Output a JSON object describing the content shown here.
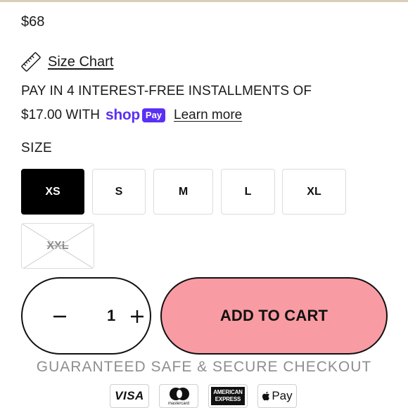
{
  "product": {
    "price": "$68"
  },
  "size_chart": {
    "label": "Size Chart",
    "icon": "ruler-icon"
  },
  "installments": {
    "line1": "PAY IN 4 INTEREST-FREE INSTALLMENTS OF",
    "amount_text": "$17.00 WITH",
    "shop_logo": "shop",
    "pay_badge": "Pay",
    "learn_more": "Learn more",
    "brand_color": "#5a31f4"
  },
  "size_selector": {
    "label": "SIZE",
    "options": [
      {
        "label": "XS",
        "state": "selected"
      },
      {
        "label": "S",
        "state": "available"
      },
      {
        "label": "M",
        "state": "available"
      },
      {
        "label": "L",
        "state": "available"
      },
      {
        "label": "XL",
        "state": "available"
      },
      {
        "label": "XXL",
        "state": "sold-out"
      }
    ]
  },
  "quantity": {
    "value": "1",
    "minus_symbol": "−",
    "plus_symbol": "+"
  },
  "cart": {
    "add_label": "ADD TO CART",
    "button_color": "#f99ba2"
  },
  "checkout": {
    "guarantee_text": "GUARANTEED SAFE & SECURE CHECKOUT",
    "payment_methods": [
      {
        "name": "visa-icon",
        "label": "VISA"
      },
      {
        "name": "mastercard-icon",
        "label": "mastercard"
      },
      {
        "name": "amex-icon",
        "label_top": "AMERICAN",
        "label_bottom": "EXPRESS"
      },
      {
        "name": "apple-pay-icon",
        "label": "Pay"
      }
    ]
  }
}
